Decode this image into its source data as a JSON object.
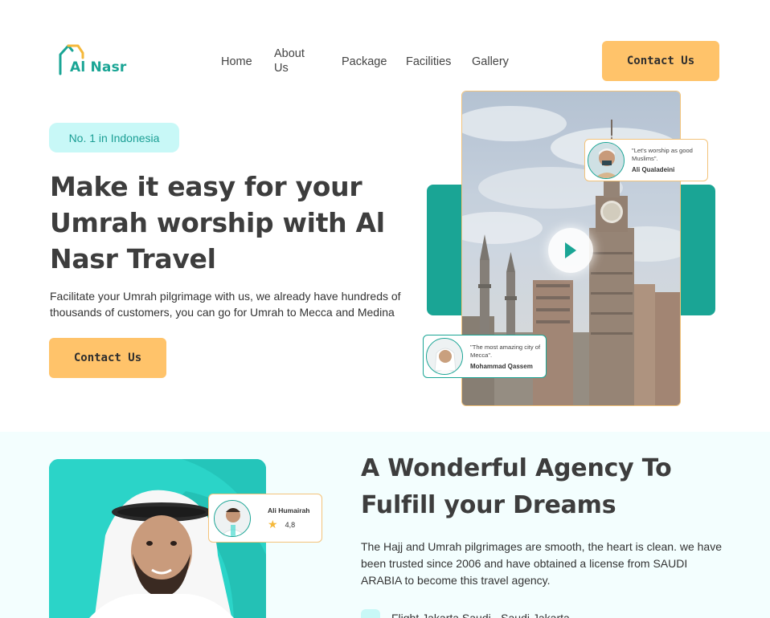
{
  "brand": {
    "name": "Al Nasr",
    "accent": "#1aa595",
    "cta_color": "#ffc36a",
    "badge_bg": "#c8f8f7",
    "logo_icon": "house-outline-icon"
  },
  "nav": {
    "items": [
      "Home",
      "About Us",
      "Package",
      "Facilities",
      "Gallery"
    ],
    "cta": "Contact Us"
  },
  "hero": {
    "badge": "No. 1 in Indonesia",
    "title": "Make it easy for your Umrah worship with Al Nasr Travel",
    "description": "Facilitate your Umrah pilgrimage with us, we already have hundreds of thousands of customers, you can go for Umrah to Mecca and Medina",
    "cta": "Contact Us",
    "play_icon": "play-icon",
    "testimonials": [
      {
        "quote": "\"Let's worship as good Muslims\".",
        "name": "Ali Qualadeini"
      },
      {
        "quote": "\"The most amazing city of Mecca\".",
        "name": "Mohammad Qassem"
      }
    ]
  },
  "about": {
    "title": "A Wonderful Agency To Fulfill your Dreams",
    "description": "The Hajj and Umrah pilgrimages are smooth, the heart is clean. we have been trusted since 2006 and have obtained a license from SAUDI ARABIA to become this travel agency.",
    "rating_card": {
      "name": "Ali Humairah",
      "rating": "4,8",
      "icon": "star-icon"
    },
    "features": [
      "Flight Jakarta Saudi - Saudi Jakarta"
    ]
  }
}
